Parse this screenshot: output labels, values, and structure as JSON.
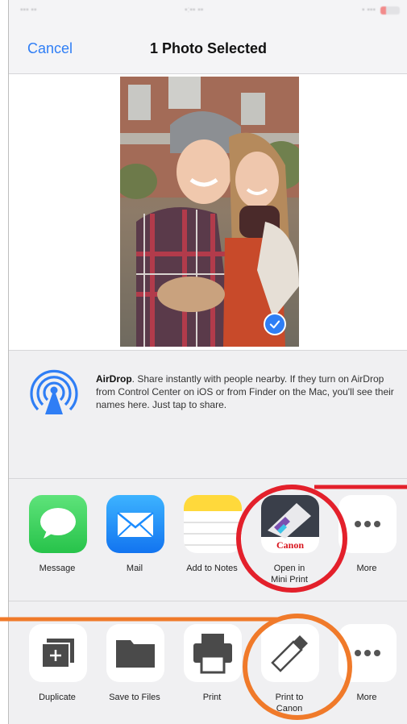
{
  "nav": {
    "cancel_label": "Cancel",
    "title": "1 Photo Selected"
  },
  "airdrop": {
    "title": "AirDrop",
    "description": ". Share instantly with people nearby. If they turn on AirDrop from Control Center on iOS or from Finder on the Mac, you'll see their names here. Just tap to share."
  },
  "apps": [
    {
      "label": "Message",
      "icon": "message-icon"
    },
    {
      "label": "Mail",
      "icon": "mail-icon"
    },
    {
      "label": "Add to Notes",
      "icon": "notes-icon"
    },
    {
      "label": "Open in\nMini Print",
      "icon": "canon-mini-print-icon",
      "brand": "Canon"
    },
    {
      "label": "More",
      "icon": "more-icon"
    }
  ],
  "actions": [
    {
      "label": "Duplicate",
      "icon": "duplicate-icon"
    },
    {
      "label": "Save to Files",
      "icon": "folder-icon"
    },
    {
      "label": "Print",
      "icon": "printer-icon"
    },
    {
      "label": "Print to\nCanon",
      "icon": "print-to-canon-icon"
    },
    {
      "label": "More",
      "icon": "more-icon"
    }
  ],
  "colors": {
    "accent": "#2f7ef5",
    "annotation_red": "#e3202b",
    "annotation_orange": "#f07a2a",
    "message_green": "#4cd964",
    "mail_blue": "#1a8cff",
    "notes_yellow": "#ffd93b"
  }
}
